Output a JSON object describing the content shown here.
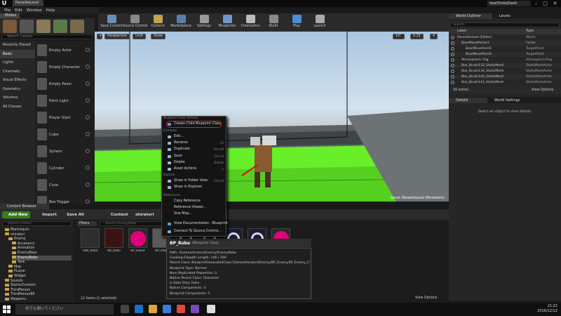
{
  "window": {
    "level_tab": "ParasiteLevel",
    "app_title": "IwaOtokoDash",
    "min": "–",
    "max": "□",
    "close": "✕"
  },
  "menu": [
    "File",
    "Edit",
    "Window",
    "Help"
  ],
  "modes": {
    "tab": "Modes",
    "search_placeholder": "Search Classes"
  },
  "categories": [
    "Recently Placed",
    "Basic",
    "Lights",
    "Cinematic",
    "Visual Effects",
    "Geometry",
    "Volumes",
    "All Classes"
  ],
  "actors": [
    "Empty Actor",
    "Empty Character",
    "Empty Pawn",
    "Point Light",
    "Player Start",
    "Cube",
    "Sphere",
    "Cylinder",
    "Cone",
    "Box Trigger",
    "Sphere Trigger"
  ],
  "toolbar": [
    {
      "label": "Save Current",
      "color": "#6a8fb5"
    },
    {
      "label": "Source Control",
      "color": "#888"
    },
    {
      "label": "Content",
      "color": "#c8a24a"
    },
    {
      "label": "Marketplace",
      "color": "#5a7ea8"
    },
    {
      "label": "Settings",
      "color": "#999"
    },
    {
      "label": "Blueprints",
      "color": "#6d98c9"
    },
    {
      "label": "Cinematics",
      "color": "#bbb"
    },
    {
      "label": "Build",
      "color": "#8a8a8a"
    },
    {
      "label": "Play",
      "color": "#4d8dd6"
    },
    {
      "label": "Launch",
      "color": "#aaa"
    }
  ],
  "viewport": {
    "perspective": "Perspective",
    "unlit": "Unlit",
    "show": "Show",
    "snap_angle": "10°",
    "snap_scale": "0.25",
    "camera_speed": "4",
    "footer": "Level: ParasiteLevel (Persistent)"
  },
  "world_outliner": {
    "tab": "World Outliner",
    "tab2": "Levels",
    "search_placeholder": "Search",
    "col_label": "Label",
    "col_type": "Type",
    "rows": [
      {
        "label": "ParasiteLevel (Editor)",
        "type": "World",
        "indent": 0
      },
      {
        "label": "BearMovePoints1",
        "type": "Folder",
        "indent": 1
      },
      {
        "label": "BearMovePoint1",
        "type": "TargetPoint",
        "indent": 2
      },
      {
        "label": "BearMovePoint2",
        "type": "TargetPoint",
        "indent": 2
      },
      {
        "label": "Atmospheric Fog",
        "type": "AtmosphericFog",
        "indent": 1
      },
      {
        "label": "Box_Brush132_StaticMesh",
        "type": "StaticMeshActor",
        "indent": 1
      },
      {
        "label": "Box_Brush134_StaticMesh",
        "type": "StaticMeshActor",
        "indent": 1
      },
      {
        "label": "Box_Brush140_StaticMesh",
        "type": "StaticMeshActor",
        "indent": 1
      },
      {
        "label": "Box_Brush141_StaticMesh",
        "type": "StaticMeshActor",
        "indent": 1
      }
    ],
    "count": "16 actors",
    "view_options": "View Options"
  },
  "details": {
    "tab": "Details",
    "tab2": "World Settings",
    "message": "Select an object to view details."
  },
  "content_browser": {
    "tab": "Content Browser",
    "add_new": "Add New",
    "import": "Import",
    "save_all": "Save All",
    "path": [
      "Content",
      "shiratori"
    ],
    "filters": "Filters",
    "search_placeholder": "Search EnemyRobo",
    "folder_search_placeholder": "Search Folders",
    "tree": [
      {
        "label": "Mannequin",
        "indent": 1
      },
      {
        "label": "shiratori",
        "indent": 1
      },
      {
        "label": "Enemy",
        "indent": 2
      },
      {
        "label": "Accessory",
        "indent": 3
      },
      {
        "label": "Animation",
        "indent": 3
      },
      {
        "label": "EnemyBear",
        "indent": 3
      },
      {
        "label": "EnemyRobo",
        "indent": 3,
        "selected": true
      },
      {
        "label": "Task",
        "indent": 3
      },
      {
        "label": "Map",
        "indent": 2
      },
      {
        "label": "PLayer",
        "indent": 2
      },
      {
        "label": "Widget",
        "indent": 2
      },
      {
        "label": "Sounds",
        "indent": 1
      },
      {
        "label": "StarterContent",
        "indent": 1
      },
      {
        "label": "ThirdPerson",
        "indent": 1
      },
      {
        "label": "ThirdPersonBP",
        "indent": 1
      },
      {
        "label": "Weapons",
        "indent": 1
      }
    ],
    "assets": [
      {
        "name": "ABP_Robo",
        "color": "#2e2e2e"
      },
      {
        "name": "BB_Robo",
        "color": "#3a1414"
      },
      {
        "name": "BP_EShot",
        "color": "#e0007a"
      },
      {
        "name": "BP_Robo",
        "color": "#5a5a5a"
      },
      {
        "name": "",
        "color": "#1e1e2e"
      },
      {
        "name": "",
        "color": "#1e1e2e"
      },
      {
        "name": "",
        "color": "#1e1e2e"
      },
      {
        "name": "",
        "color": "#1e1e2e"
      },
      {
        "name": "M_EShot",
        "color": "#e0007a"
      }
    ],
    "status": "12 items (1 selected)",
    "view_options": "View Options"
  },
  "context_menu": {
    "header1": "Blueprint Class Actions",
    "create_child": "Create Child Blueprint Class",
    "header2": "Common",
    "items": [
      {
        "label": "Edit...",
        "key": ""
      },
      {
        "label": "Rename",
        "key": "F2"
      },
      {
        "label": "Duplicate",
        "key": "Ctrl+W"
      },
      {
        "label": "Save",
        "key": "Ctrl+S"
      },
      {
        "label": "Delete",
        "key": "Delete"
      },
      {
        "label": "Asset Actions",
        "key": "▸"
      }
    ],
    "header3": "Explore",
    "explore": [
      {
        "label": "Show in Folder View",
        "key": "Ctrl+B"
      },
      {
        "label": "Show in Explorer",
        "key": ""
      }
    ],
    "header4": "References",
    "refs": [
      {
        "label": "Copy Reference",
        "key": ""
      },
      {
        "label": "Reference Viewer...",
        "key": ""
      },
      {
        "label": "Size Map...",
        "key": ""
      }
    ],
    "view_doc": "View Documentation - Blueprint",
    "source_control": "Connect To Source Control..."
  },
  "tooltip": {
    "title": "BP_Robo",
    "subtitle": "(Blueprint Class)",
    "lines": [
      "Path: /Game/shiratori/Enemy/EnemyRobo",
      "Cooking Filepath Length: 146 / 260",
      "Parent Class: BlueprintGeneratedClass'/Game/shiratori/Enemy/BP_Enemy.BP_Enemy_C'",
      "Blueprint Type: Normal",
      "Num Replicated Properties: 0",
      "Native Parent Class: Character",
      "Is Data Only: False",
      "Native Components: 4",
      "Blueprint Components: 1"
    ]
  },
  "taskbar": {
    "search": "何でも聞いてください",
    "time": "21:22",
    "date": "2016/12/12"
  }
}
